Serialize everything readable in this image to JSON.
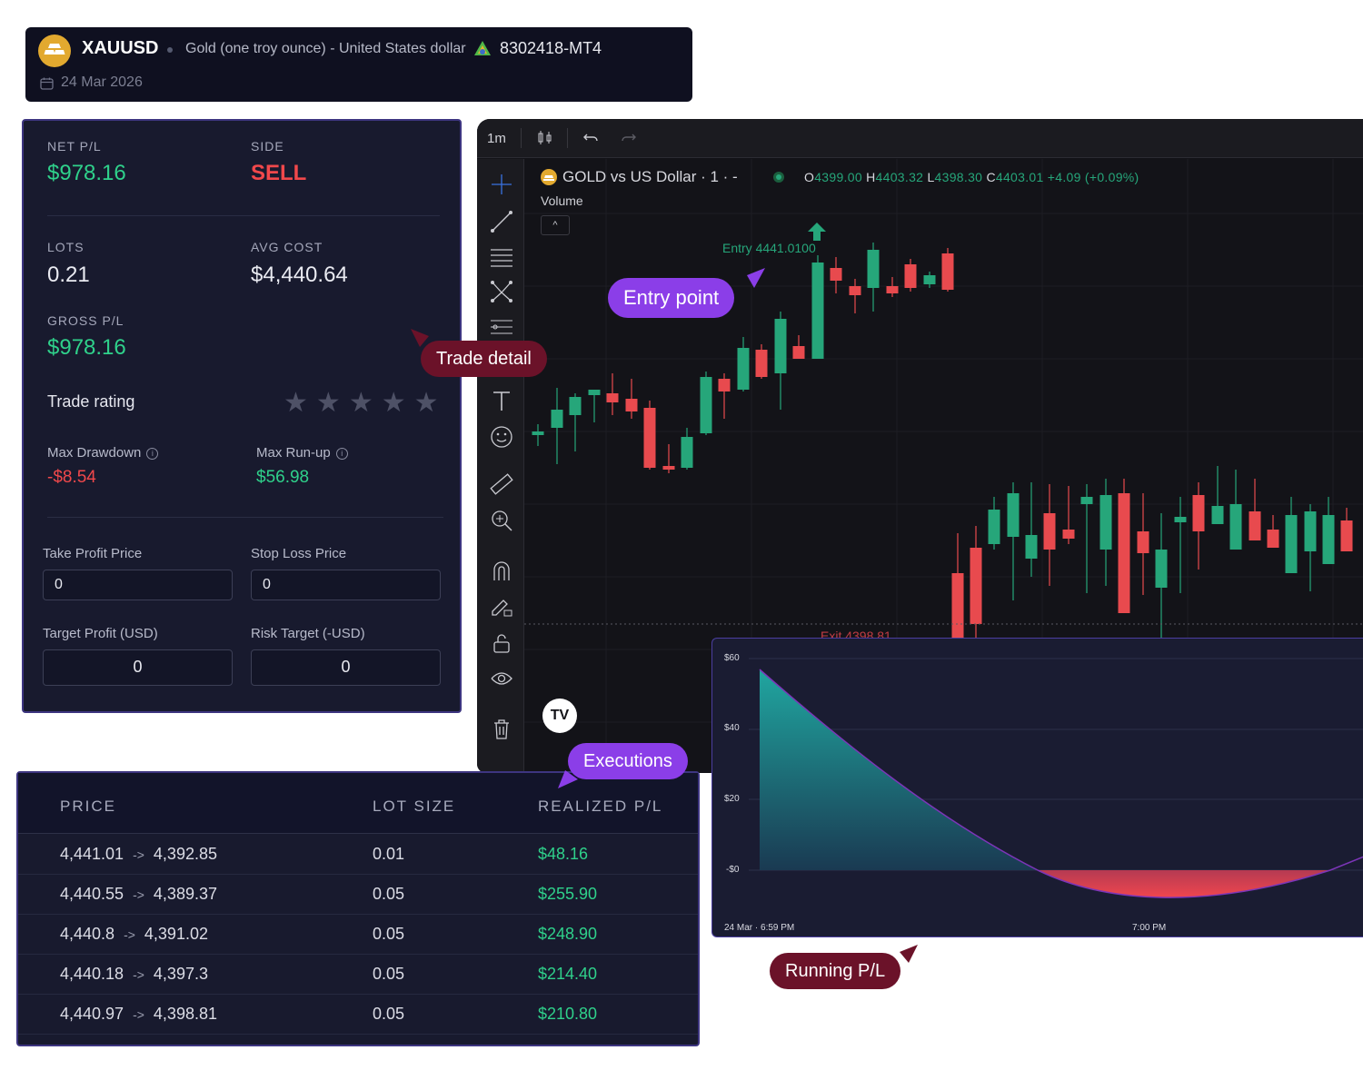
{
  "header": {
    "symbol": "XAUUSD",
    "description": "Gold (one troy ounce) - United States dollar",
    "account": "8302418-MT4",
    "date": "24 Mar 2026"
  },
  "trade": {
    "net_pl_label": "NET P/L",
    "net_pl": "$978.16",
    "side_label": "SIDE",
    "side": "SELL",
    "lots_label": "LOTS",
    "lots": "0.21",
    "avg_cost_label": "AVG COST",
    "avg_cost": "$4,440.64",
    "gross_pl_label": "GROSS P/L",
    "gross_pl": "$978.16",
    "rating_label": "Trade rating",
    "rating": 0,
    "max_drawdown_label": "Max Drawdown",
    "max_drawdown": "-$8.54",
    "max_runup_label": "Max Run-up",
    "max_runup": "$56.98",
    "take_profit_label": "Take Profit Price",
    "take_profit": "0",
    "stop_loss_label": "Stop Loss Price",
    "stop_loss": "0",
    "target_profit_label": "Target Profit (USD)",
    "target_profit": "0",
    "risk_target_label": "Risk Target (-USD)",
    "risk_target": "0"
  },
  "callouts": {
    "trade_detail": "Trade detail",
    "entry_point": "Entry point",
    "executions": "Executions",
    "running_pl": "Running P/L"
  },
  "chart": {
    "timeframe": "1m",
    "title": "GOLD vs US Dollar · 1 · -",
    "ohlc": {
      "o": "4399.00",
      "h": "4403.32",
      "l": "4398.30",
      "c": "4403.01",
      "change": "+4.09 (+0.09%)"
    },
    "volume_label": "Volume",
    "entry_label": "Entry 4441.0100",
    "exit_label": "Exit 4398.81",
    "logo": "TV"
  },
  "running_pl": {
    "y_ticks": [
      "$60",
      "$40",
      "$20",
      "-$0"
    ],
    "x_ticks": [
      "24 Mar · 6:59 PM",
      "7:00 PM"
    ]
  },
  "executions": {
    "columns": [
      "PRICE",
      "LOT SIZE",
      "REALIZED P/L"
    ],
    "rows": [
      {
        "from": "4,441.01",
        "to": "4,392.85",
        "lot": "0.01",
        "pl": "$48.16"
      },
      {
        "from": "4,440.55",
        "to": "4,389.37",
        "lot": "0.05",
        "pl": "$255.90"
      },
      {
        "from": "4,440.8",
        "to": "4,391.02",
        "lot": "0.05",
        "pl": "$248.90"
      },
      {
        "from": "4,440.18",
        "to": "4,397.3",
        "lot": "0.05",
        "pl": "$214.40"
      },
      {
        "from": "4,440.97",
        "to": "4,398.81",
        "lot": "0.05",
        "pl": "$210.80"
      }
    ],
    "arrow": "->"
  },
  "colors": {
    "profit": "#2fd18b",
    "loss": "#f1484b",
    "accent": "#8b3ee8",
    "callout_dark": "#6b1229",
    "candle_up": "#26a67a",
    "candle_down": "#e84a4e"
  }
}
